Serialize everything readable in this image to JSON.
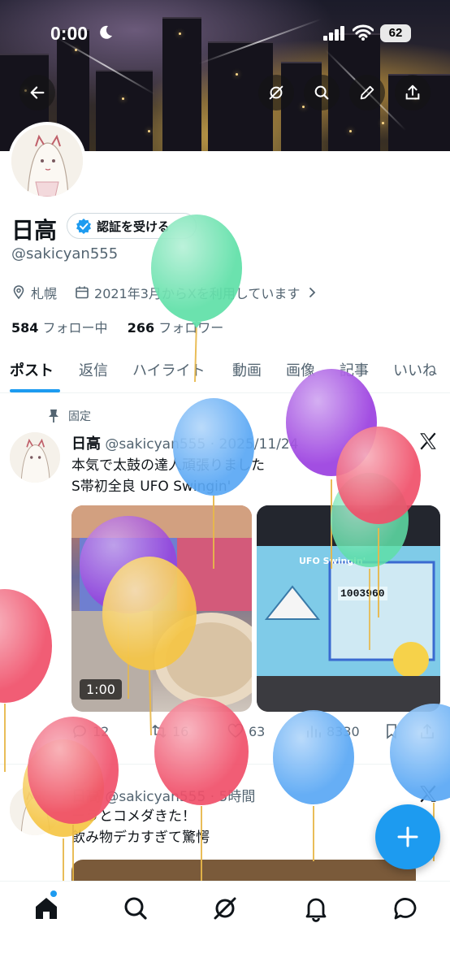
{
  "status_bar": {
    "time": "0:00",
    "battery": "62"
  },
  "profile": {
    "name": "日高",
    "verify_label": "認証を受ける",
    "handle": "@sakicyan555",
    "location": "札幌",
    "joined": "2021年3月からXを利用しています",
    "following_count": "584",
    "following_label": "フォロー中",
    "followers_count": "266",
    "followers_label": "フォロワー"
  },
  "tabs": [
    "ポスト",
    "返信",
    "ハイライト",
    "動画",
    "画像",
    "記事",
    "いいね"
  ],
  "posts": [
    {
      "pinned_label": "固定",
      "author": "日高",
      "handle": "@sakicyan555",
      "time": "2025/11/24",
      "lines": [
        "本気で太鼓の達人頑張りました",
        "S帯初全良 UFO Swingin'"
      ],
      "video_duration": "1:00",
      "media_text": "UFO Swingin'",
      "media_score": "1003960",
      "replies": "12",
      "reposts": "16",
      "likes": "63",
      "views": "8330"
    },
    {
      "author": "日高",
      "handle": "@sakicyan555",
      "time": "5時間",
      "lines": [
        "ーうとコメダきた！",
        "飲み物デカすぎて驚愕"
      ]
    }
  ],
  "colors": {
    "accent": "#1d9bf0",
    "text": "#0f1419",
    "muted": "#536471"
  },
  "icons": {
    "top_bar": [
      "back-arrow-icon",
      "grok-icon",
      "search-icon",
      "edit-pencil-icon",
      "share-icon"
    ],
    "bottom_nav": [
      "home-icon",
      "search-icon",
      "grok-icon",
      "bell-icon",
      "messages-icon"
    ]
  }
}
